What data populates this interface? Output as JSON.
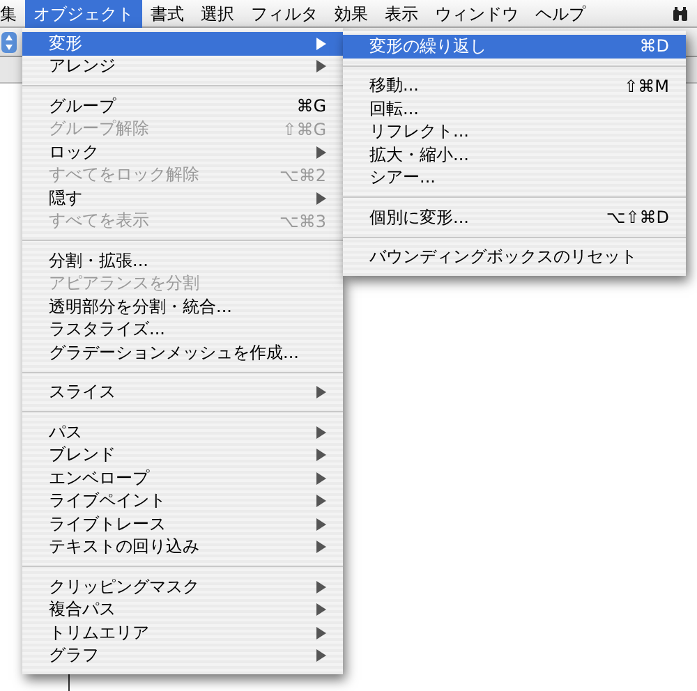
{
  "menubar": [
    {
      "label": "集",
      "selected": false
    },
    {
      "label": "オブジェクト",
      "selected": true
    },
    {
      "label": "書式",
      "selected": false
    },
    {
      "label": "選択",
      "selected": false
    },
    {
      "label": "フィルタ",
      "selected": false
    },
    {
      "label": "効果",
      "selected": false
    },
    {
      "label": "表示",
      "selected": false
    },
    {
      "label": "ウィンドウ",
      "selected": false
    },
    {
      "label": "ヘルプ",
      "selected": false
    }
  ],
  "object_menu": [
    [
      {
        "label": "変形",
        "submenu": true,
        "disabled": false,
        "selected": true
      },
      {
        "label": "アレンジ",
        "submenu": true,
        "disabled": false,
        "selected": false
      }
    ],
    [
      {
        "label": "グループ",
        "shortcut": "⌘G",
        "disabled": false,
        "selected": false
      },
      {
        "label": "グループ解除",
        "shortcut": "⇧⌘G",
        "disabled": true,
        "selected": false
      },
      {
        "label": "ロック",
        "submenu": true,
        "disabled": false,
        "selected": false
      },
      {
        "label": "すべてをロック解除",
        "shortcut": "⌥⌘2",
        "disabled": true,
        "selected": false
      },
      {
        "label": "隠す",
        "submenu": true,
        "disabled": false,
        "selected": false
      },
      {
        "label": "すべてを表示",
        "shortcut": "⌥⌘3",
        "disabled": true,
        "selected": false
      }
    ],
    [
      {
        "label": "分割・拡張...",
        "disabled": false,
        "selected": false
      },
      {
        "label": "アピアランスを分割",
        "disabled": true,
        "selected": false
      },
      {
        "label": "透明部分を分割・統合...",
        "disabled": false,
        "selected": false
      },
      {
        "label": "ラスタライズ...",
        "disabled": false,
        "selected": false
      },
      {
        "label": "グラデーションメッシュを作成...",
        "disabled": false,
        "selected": false
      }
    ],
    [
      {
        "label": "スライス",
        "submenu": true,
        "disabled": false,
        "selected": false
      }
    ],
    [
      {
        "label": "パス",
        "submenu": true,
        "disabled": false,
        "selected": false
      },
      {
        "label": "ブレンド",
        "submenu": true,
        "disabled": false,
        "selected": false
      },
      {
        "label": "エンベロープ",
        "submenu": true,
        "disabled": false,
        "selected": false
      },
      {
        "label": "ライブペイント",
        "submenu": true,
        "disabled": false,
        "selected": false
      },
      {
        "label": "ライブトレース",
        "submenu": true,
        "disabled": false,
        "selected": false
      },
      {
        "label": "テキストの回り込み",
        "submenu": true,
        "disabled": false,
        "selected": false
      }
    ],
    [
      {
        "label": "クリッピングマスク",
        "submenu": true,
        "disabled": false,
        "selected": false
      },
      {
        "label": "複合パス",
        "submenu": true,
        "disabled": false,
        "selected": false
      },
      {
        "label": "トリムエリア",
        "submenu": true,
        "disabled": false,
        "selected": false
      },
      {
        "label": "グラフ",
        "submenu": true,
        "disabled": false,
        "selected": false
      }
    ]
  ],
  "transform_submenu": [
    [
      {
        "label": "変形の繰り返し",
        "shortcut": "⌘D",
        "disabled": false,
        "selected": true
      }
    ],
    [
      {
        "label": "移動...",
        "shortcut": "⇧⌘M",
        "disabled": false,
        "selected": false
      },
      {
        "label": "回転...",
        "disabled": false,
        "selected": false
      },
      {
        "label": "リフレクト...",
        "disabled": false,
        "selected": false
      },
      {
        "label": "拡大・縮小...",
        "disabled": false,
        "selected": false
      },
      {
        "label": "シアー...",
        "disabled": false,
        "selected": false
      }
    ],
    [
      {
        "label": "個別に変形...",
        "shortcut": "⌥⇧⌘D",
        "disabled": false,
        "selected": false
      }
    ],
    [
      {
        "label": "バウンディングボックスのリセット",
        "disabled": false,
        "selected": false
      }
    ]
  ]
}
